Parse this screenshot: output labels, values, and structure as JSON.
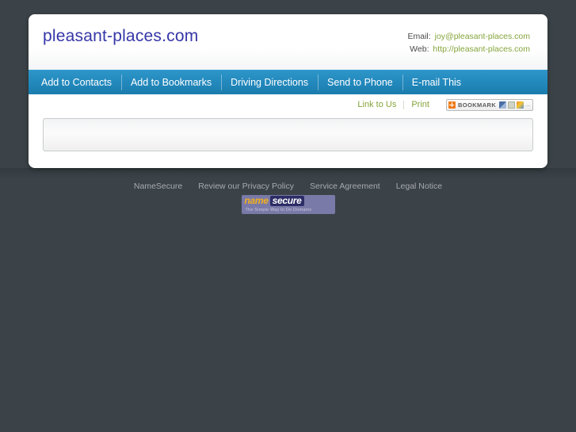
{
  "page": {
    "background_color": "#3b4348"
  },
  "header": {
    "site_title": "pleasant-places.com",
    "title_color": "#3636a8",
    "contact": [
      {
        "label": "Email:",
        "value": "joy@pleasant-places.com"
      },
      {
        "label": "Web:",
        "value": "http://pleasant-places.com"
      }
    ],
    "value_color": "#85a53c"
  },
  "navbar": {
    "background_color": "#2389bd",
    "items": [
      {
        "label": "Add to Contacts",
        "name": "nav-add-to-contacts"
      },
      {
        "label": "Add to Bookmarks",
        "name": "nav-add-to-bookmarks"
      },
      {
        "label": "Driving Directions",
        "name": "nav-driving-directions"
      },
      {
        "label": "Send to Phone",
        "name": "nav-send-to-phone"
      },
      {
        "label": "E-mail This",
        "name": "nav-email-this"
      }
    ]
  },
  "utility": {
    "link_to_us": "Link to Us",
    "print": "Print",
    "link_color": "#85a53c",
    "bookmark_widget": {
      "label": "BOOKMARK",
      "plus_icon_color": "#f07c1b",
      "more_label": "...",
      "share_icons": [
        "windows-live-icon",
        "mixx-icon",
        "google-share-icon"
      ]
    }
  },
  "content": {
    "panel_empty": true
  },
  "footer": {
    "links": [
      {
        "label": "NameSecure",
        "name": "footer-link-namesecure"
      },
      {
        "label": "Review our Privacy Policy",
        "name": "footer-link-privacy-policy"
      },
      {
        "label": "Service Agreement",
        "name": "footer-link-service-agreement"
      },
      {
        "label": "Legal Notice",
        "name": "footer-link-legal-notice"
      }
    ],
    "link_color": "#a8aab0",
    "logo": {
      "name_part": "name",
      "secure_part": "secure",
      "tagline": "The Simple Way to Do Domains",
      "name_color": "#f2b01e",
      "secure_bg_color": "#2c2c66"
    }
  }
}
